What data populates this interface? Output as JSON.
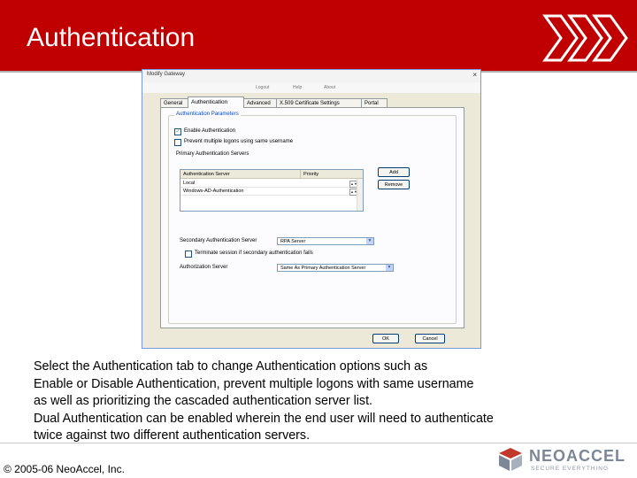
{
  "slide": {
    "title": "Authentication",
    "caption_lines": [
      "Select the Authentication tab to change Authentication options such as",
      "Enable or Disable Authentication, prevent multiple logons with same username",
      "as well as prioritizing the cascaded authentication server list.",
      "Dual Authentication can be enabled wherein the end user will need to authenticate",
      "twice against two different authentication servers."
    ],
    "copyright": "© 2005-06 NeoAccel, Inc."
  },
  "brand": {
    "name": "NEOACCEL",
    "tagline": "SECURE EVERYTHING",
    "banner_color": "#c00000"
  },
  "dialog": {
    "title": "Modify Gateway",
    "close_glyph": "×",
    "toolbar": [
      "Logout",
      "Help",
      "About"
    ],
    "tabs": [
      "General",
      "Authentication",
      "Advanced",
      "X.509 Certificate Settings",
      "Portal"
    ],
    "active_tab": "Authentication",
    "group_title": "Authentication Parameters",
    "enable_auth": {
      "label": "Enable Authentication",
      "checked": true,
      "mark": "✓"
    },
    "prevent_multiple": {
      "label": "Prevent multiple logons using same username",
      "checked": false
    },
    "primary_servers_label": "Primary Authentication Servers",
    "table": {
      "headers": [
        "Authentication Server",
        "Priority"
      ],
      "rows": [
        {
          "server": "Local",
          "priority": ""
        },
        {
          "server": "Windows-AD-Authentication",
          "priority": ""
        }
      ]
    },
    "add_label": "Add",
    "remove_label": "Remove",
    "secondary_label": "Secondary Authentication Server",
    "secondary_value": "RPA Server",
    "terminate": {
      "label": "Terminate session if secondary authentication fails",
      "checked": false
    },
    "authorization_label": "Authorization Server",
    "authorization_value": "Same As Primary Authentication Server",
    "ok_label": "OK",
    "cancel_label": "Cancel"
  }
}
